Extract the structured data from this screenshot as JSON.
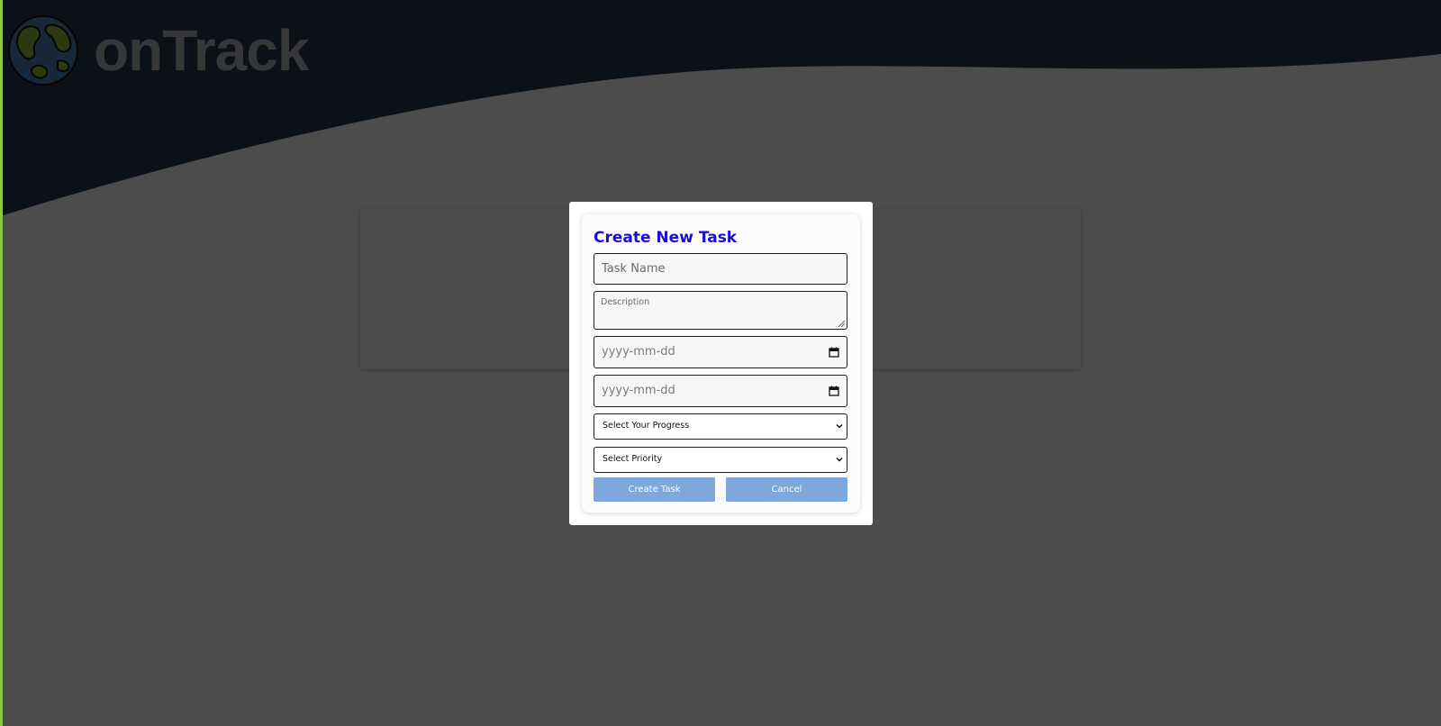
{
  "app": {
    "brand_name": "onTrack",
    "colors": {
      "header": "#263a4f",
      "accent_stripe": "#8dc63f",
      "title": "#1a0fd0",
      "button": "#7ea7db"
    }
  },
  "modal": {
    "title": "Create New Task",
    "task_name": {
      "placeholder": "Task Name",
      "value": ""
    },
    "description": {
      "placeholder": "Description",
      "value": ""
    },
    "start_date": {
      "placeholder": "yyyy-mm-dd",
      "icon": "calendar-icon"
    },
    "end_date": {
      "placeholder": "yyyy-mm-dd",
      "icon": "calendar-icon"
    },
    "progress_select": {
      "selected": "Select Your Progress",
      "icon": "chevron-down-icon"
    },
    "priority_select": {
      "selected": "Select Priority",
      "icon": "chevron-down-icon"
    },
    "create_button": "Create Task",
    "cancel_button": "Cancel"
  }
}
